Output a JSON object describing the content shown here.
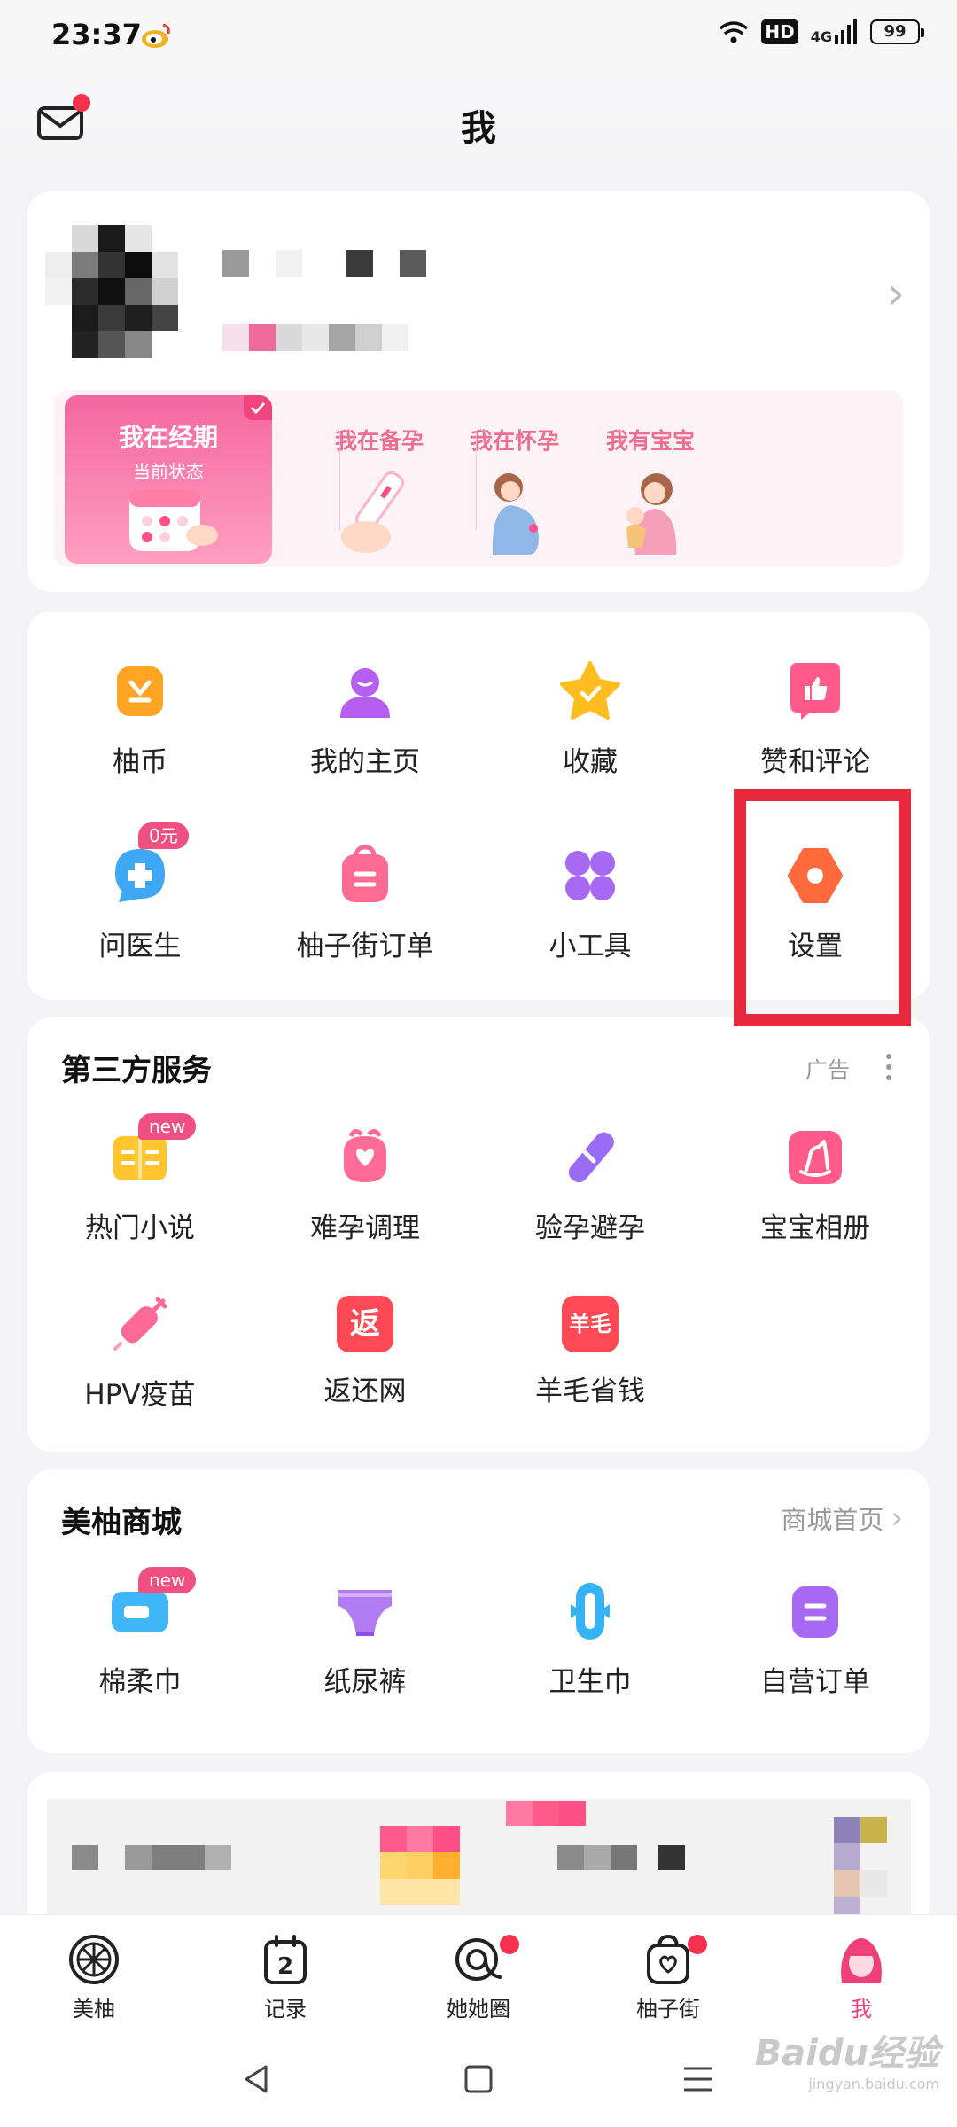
{
  "status_bar": {
    "time": "23:37",
    "hd": "HD",
    "network": "4G",
    "battery": "99"
  },
  "header": {
    "title": "我"
  },
  "profile": {
    "states": [
      {
        "title": "我在经期",
        "subtitle": "当前状态"
      },
      {
        "title": "我在备孕"
      },
      {
        "title": "我在怀孕"
      },
      {
        "title": "我有宝宝"
      }
    ]
  },
  "menu": {
    "items": [
      {
        "label": "柚币",
        "icon": "yoyo-coin-icon",
        "color": "#ffa423"
      },
      {
        "label": "我的主页",
        "icon": "person-icon",
        "color": "#b65ef0"
      },
      {
        "label": "收藏",
        "icon": "star-icon",
        "color": "#ffbd1f"
      },
      {
        "label": "赞和评论",
        "icon": "thumb-up-icon",
        "color": "#ff5a8a"
      },
      {
        "label": "问医生",
        "icon": "doctor-chat-icon",
        "color": "#3ea8f5",
        "badge": "0元"
      },
      {
        "label": "柚子街订单",
        "icon": "order-bag-icon",
        "color": "#ff6c93"
      },
      {
        "label": "小工具",
        "icon": "tools-grid-icon",
        "color": "#a869f2"
      },
      {
        "label": "设置",
        "icon": "settings-icon",
        "color": "#ff6a3d"
      }
    ]
  },
  "services": {
    "title": "第三方服务",
    "ad_label": "广告",
    "items": [
      {
        "label": "热门小说",
        "icon": "novel-book-icon",
        "badge": "new"
      },
      {
        "label": "难孕调理",
        "icon": "fertility-care-icon"
      },
      {
        "label": "验孕避孕",
        "icon": "pregnancy-test-icon"
      },
      {
        "label": "宝宝相册",
        "icon": "rocking-horse-icon"
      },
      {
        "label": "HPV疫苗",
        "icon": "vaccine-syringe-icon"
      },
      {
        "label": "返还网",
        "icon": "cashback-icon",
        "glyph": "返"
      },
      {
        "label": "羊毛省钱",
        "icon": "save-money-icon",
        "glyph": "羊毛"
      }
    ]
  },
  "mall": {
    "title": "美柚商城",
    "link": "商城首页",
    "items": [
      {
        "label": "棉柔巾",
        "icon": "cotton-towel-icon",
        "badge": "new"
      },
      {
        "label": "纸尿裤",
        "icon": "diaper-icon"
      },
      {
        "label": "卫生巾",
        "icon": "sanitary-pad-icon"
      },
      {
        "label": "自营订单",
        "icon": "self-order-icon"
      }
    ]
  },
  "tabs": [
    {
      "label": "美柚",
      "icon": "meiyou-logo-icon"
    },
    {
      "label": "记录",
      "icon": "calendar-record-icon",
      "day": "2"
    },
    {
      "label": "她她圈",
      "icon": "community-icon"
    },
    {
      "label": "柚子街",
      "icon": "shop-bag-icon"
    },
    {
      "label": "我",
      "icon": "me-avatar-icon",
      "active": true
    }
  ],
  "watermark": {
    "logo": "Baidu经验",
    "url": "jingyan.baidu.com"
  },
  "colors": {
    "accent_pink": "#ef3f78",
    "highlight_red": "#e8283f"
  }
}
